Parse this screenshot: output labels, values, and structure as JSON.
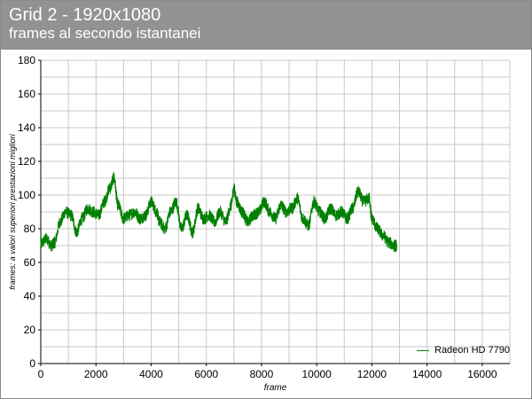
{
  "header": {
    "title": "Grid 2 - 1920x1080",
    "subtitle": "frames al secondo istantanei"
  },
  "colors": {
    "header_bg": "#929292",
    "series": "#008000",
    "grid": "#c8c8c8"
  },
  "chart_data": {
    "type": "line",
    "title": "Grid 2 - 1920x1080",
    "subtitle": "frames al secondo istantanei",
    "xlabel": "frame",
    "ylabel": "frames: a valori superiori prestazioni migliori",
    "xlim": [
      0,
      17000
    ],
    "ylim": [
      0,
      180
    ],
    "x_ticks": [
      0,
      2000,
      4000,
      6000,
      8000,
      10000,
      12000,
      14000,
      16000
    ],
    "y_ticks": [
      0,
      20,
      40,
      60,
      80,
      100,
      120,
      140,
      160,
      180
    ],
    "grid": true,
    "legend_position": "right",
    "series": [
      {
        "name": "Radeon HD 7790",
        "color": "#008000",
        "x": [
          0,
          200,
          400,
          500,
          700,
          900,
          1100,
          1300,
          1500,
          1700,
          1900,
          2100,
          2300,
          2500,
          2650,
          2800,
          3000,
          3200,
          3400,
          3600,
          3800,
          4000,
          4200,
          4300,
          4500,
          4700,
          4900,
          5100,
          5300,
          5500,
          5700,
          5900,
          6100,
          6300,
          6500,
          6700,
          6900,
          7000,
          7100,
          7300,
          7500,
          7700,
          7900,
          8100,
          8300,
          8500,
          8700,
          8900,
          9100,
          9300,
          9500,
          9700,
          9900,
          10100,
          10300,
          10500,
          10700,
          10900,
          11100,
          11300,
          11500,
          11700,
          11900,
          12000,
          12200,
          12400,
          12600,
          12800,
          12900
        ],
        "y": [
          71,
          74,
          70,
          72,
          84,
          90,
          88,
          78,
          86,
          92,
          90,
          88,
          96,
          104,
          110,
          94,
          86,
          88,
          90,
          86,
          88,
          96,
          90,
          84,
          80,
          90,
          96,
          80,
          88,
          78,
          92,
          86,
          88,
          84,
          90,
          84,
          94,
          104,
          96,
          90,
          84,
          88,
          90,
          96,
          90,
          86,
          94,
          90,
          92,
          98,
          86,
          82,
          96,
          90,
          86,
          92,
          88,
          90,
          86,
          92,
          102,
          96,
          98,
          86,
          80,
          76,
          72,
          70,
          70
        ]
      }
    ]
  }
}
